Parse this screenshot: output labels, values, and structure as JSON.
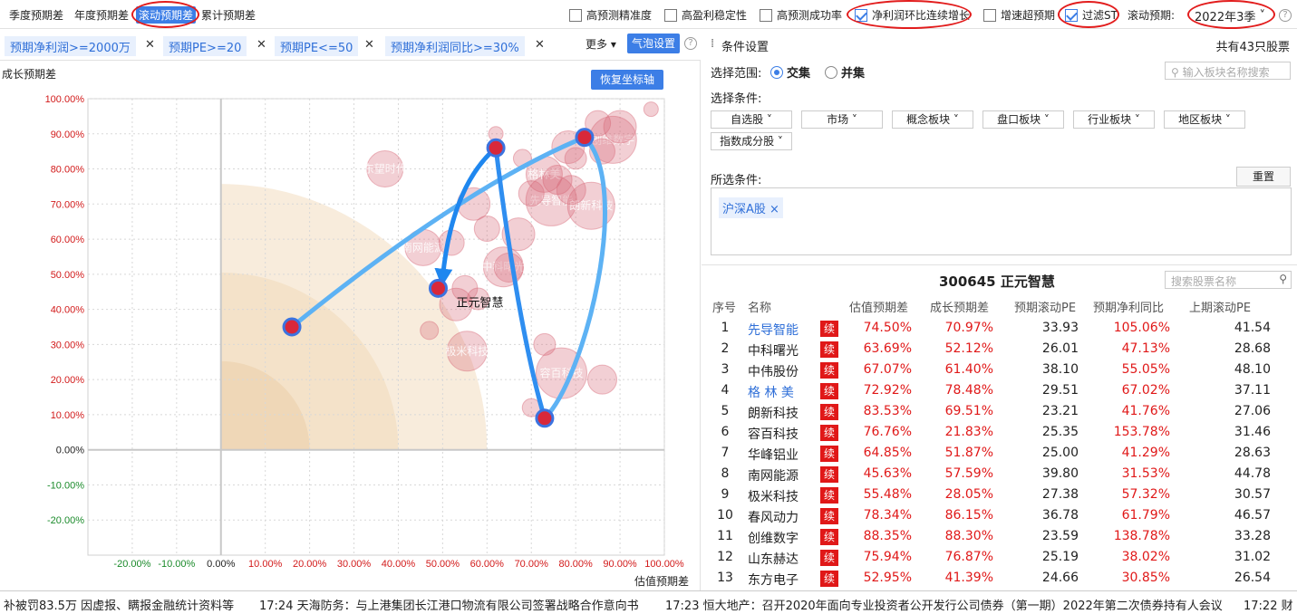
{
  "tabs": [
    "季度预期差",
    "年度预期差",
    "滚动预期差",
    "累计预期差"
  ],
  "options": [
    {
      "label": "高预测精准度",
      "checked": false
    },
    {
      "label": "高盈利稳定性",
      "checked": false
    },
    {
      "label": "高预测成功率",
      "checked": false
    },
    {
      "label": "净利润环比连续增长",
      "checked": true
    },
    {
      "label": "增速超预期",
      "checked": false
    },
    {
      "label": "过滤ST",
      "checked": true
    }
  ],
  "rolling": {
    "label": "滚动预期:",
    "value": "2022年3季"
  },
  "chips": [
    "预期净利润>=2000万",
    "预期PE>=20",
    "预期PE<=50",
    "预期净利润同比>=30%"
  ],
  "more_label": "更多",
  "bubble_settings": "气泡设置",
  "restore_axis": "恢复坐标轴",
  "chart_data": {
    "type": "scatter",
    "xlabel": "估值预期差",
    "ylabel": "成长预期差",
    "xlim": [
      -30,
      100
    ],
    "ylim": [
      -30,
      100
    ],
    "xticks": [
      "-20.00%",
      "-10.00%",
      "0.00%",
      "10.00%",
      "20.00%",
      "30.00%",
      "40.00%",
      "50.00%",
      "60.00%",
      "70.00%",
      "80.00%",
      "90.00%",
      "100.00%"
    ],
    "yticks": [
      "100.00%",
      "90.00%",
      "80.00%",
      "70.00%",
      "60.00%",
      "50.00%",
      "40.00%",
      "30.00%",
      "20.00%",
      "10.00%",
      "0.00%",
      "-10.00%",
      "-20.00%"
    ],
    "path": {
      "name": "正元智慧",
      "points": [
        [
          16,
          35
        ],
        [
          82,
          89
        ],
        [
          62,
          86
        ],
        [
          49,
          46
        ],
        [
          73,
          9
        ]
      ]
    },
    "path_order": [
      0,
      1,
      4,
      2,
      3
    ],
    "bubbles": [
      [
        74.5,
        71.0,
        28,
        "先导智能"
      ],
      [
        63.7,
        52.1,
        22,
        "中科曙光"
      ],
      [
        67.1,
        61.4,
        18,
        ""
      ],
      [
        72.9,
        78.5,
        20,
        "格林美"
      ],
      [
        83.5,
        69.5,
        26,
        "朗新科技"
      ],
      [
        76.8,
        21.8,
        28,
        "容百科技"
      ],
      [
        64.9,
        51.9,
        16,
        ""
      ],
      [
        45.6,
        57.6,
        20,
        "南网能源"
      ],
      [
        55.5,
        28.1,
        22,
        "极米科技"
      ],
      [
        78.3,
        86.2,
        18,
        ""
      ],
      [
        88.4,
        88.3,
        26,
        "创维数字"
      ],
      [
        75.9,
        76.9,
        16,
        ""
      ],
      [
        53.0,
        41.4,
        18,
        ""
      ],
      [
        37,
        80,
        20,
        "东望时代"
      ],
      [
        57,
        70,
        18,
        ""
      ],
      [
        52,
        59,
        14,
        ""
      ],
      [
        60,
        63,
        14,
        ""
      ],
      [
        73,
        30,
        12,
        ""
      ],
      [
        86,
        20,
        16,
        ""
      ],
      [
        70,
        12,
        10,
        ""
      ],
      [
        85,
        93,
        14,
        ""
      ],
      [
        90,
        92,
        18,
        ""
      ],
      [
        97,
        97,
        8,
        ""
      ],
      [
        62,
        90,
        8,
        ""
      ],
      [
        47,
        34,
        10,
        ""
      ],
      [
        55,
        46,
        14,
        ""
      ],
      [
        58,
        43,
        12,
        ""
      ],
      [
        70,
        73,
        14,
        ""
      ],
      [
        80,
        83,
        12,
        ""
      ],
      [
        68,
        83,
        10,
        ""
      ],
      [
        79,
        74,
        16,
        ""
      ],
      [
        86,
        85,
        14,
        ""
      ]
    ]
  },
  "panel": {
    "title": "条件设置",
    "count": "共有43只股票",
    "range_label": "选择范围:",
    "range_opt1": "交集",
    "range_opt2": "并集",
    "search_placeholder": "输入板块名称搜索",
    "cond_label": "选择条件:",
    "dropdowns": [
      "自选股",
      "市场",
      "概念板块",
      "盘口板块",
      "行业板块",
      "地区板块",
      "指数成分股"
    ],
    "selected_label": "所选条件:",
    "reset": "重置",
    "selected_tag": "沪深A股 ×",
    "stock_title": "300645  正元智慧",
    "stock_search": "搜索股票名称"
  },
  "table": {
    "headers": [
      "序号",
      "名称",
      "估值预期差",
      "成长预期差",
      "预期滚动PE",
      "预期净利同比",
      "上期滚动PE"
    ],
    "badge": "续",
    "rows": [
      [
        "1",
        "先导智能",
        "74.50%",
        "70.97%",
        "33.93",
        "105.06%",
        "41.54",
        true
      ],
      [
        "2",
        "中科曙光",
        "63.69%",
        "52.12%",
        "26.01",
        "47.13%",
        "28.68",
        false
      ],
      [
        "3",
        "中伟股份",
        "67.07%",
        "61.40%",
        "38.10",
        "55.05%",
        "48.10",
        false
      ],
      [
        "4",
        "格 林 美",
        "72.92%",
        "78.48%",
        "29.51",
        "67.02%",
        "37.11",
        true
      ],
      [
        "5",
        "朗新科技",
        "83.53%",
        "69.51%",
        "23.21",
        "41.76%",
        "27.06",
        false
      ],
      [
        "6",
        "容百科技",
        "76.76%",
        "21.83%",
        "25.35",
        "153.78%",
        "31.46",
        false
      ],
      [
        "7",
        "华峰铝业",
        "64.85%",
        "51.87%",
        "25.00",
        "41.29%",
        "28.63",
        false
      ],
      [
        "8",
        "南网能源",
        "45.63%",
        "57.59%",
        "39.80",
        "31.53%",
        "44.78",
        false
      ],
      [
        "9",
        "极米科技",
        "55.48%",
        "28.05%",
        "27.38",
        "57.32%",
        "30.57",
        false
      ],
      [
        "10",
        "春风动力",
        "78.34%",
        "86.15%",
        "36.78",
        "61.79%",
        "46.57",
        false
      ],
      [
        "11",
        "创维数字",
        "88.35%",
        "88.30%",
        "23.59",
        "138.78%",
        "33.28",
        false
      ],
      [
        "12",
        "山东赫达",
        "75.94%",
        "76.87%",
        "25.19",
        "38.02%",
        "31.02",
        false
      ],
      [
        "13",
        "东方电子",
        "52.95%",
        "41.39%",
        "24.66",
        "30.85%",
        "26.54",
        false
      ]
    ]
  },
  "ticker": [
    "补被罚83.5万 因虚报、瞒报金融统计资料等",
    "17:24 天海防务：与上港集团长江港口物流有限公司签署战略合作意向书",
    "17:23 恒大地产：召开2020年面向专业投资者公开发行公司债券（第一期）2022年第二次债券持有人会议",
    "17:22 财"
  ]
}
